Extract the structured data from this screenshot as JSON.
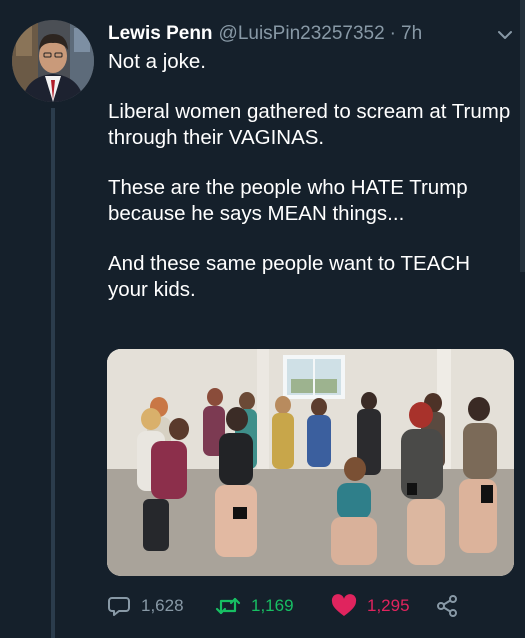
{
  "tweet": {
    "display_name": "Lewis Penn",
    "handle": "@LuisPin23257352",
    "separator": "·",
    "time": "7h",
    "paragraphs": [
      "Not a joke.",
      "Liberal women gathered to scream at Trump through their VAGINAS.",
      "These are the  people who HATE Trump because he says MEAN things...",
      "And these same people want to TEACH your kids."
    ]
  },
  "actions": {
    "replies": "1,628",
    "retweets": "1,169",
    "likes": "1,295"
  },
  "icons": {
    "menu": "chevron-down-icon",
    "reply": "reply-icon",
    "retweet": "retweet-icon",
    "like": "heart-icon",
    "share": "share-icon"
  },
  "colors": {
    "background": "#15202b",
    "secondary_text": "#8899a6",
    "retweet": "#17bf63",
    "like": "#e0245e"
  }
}
